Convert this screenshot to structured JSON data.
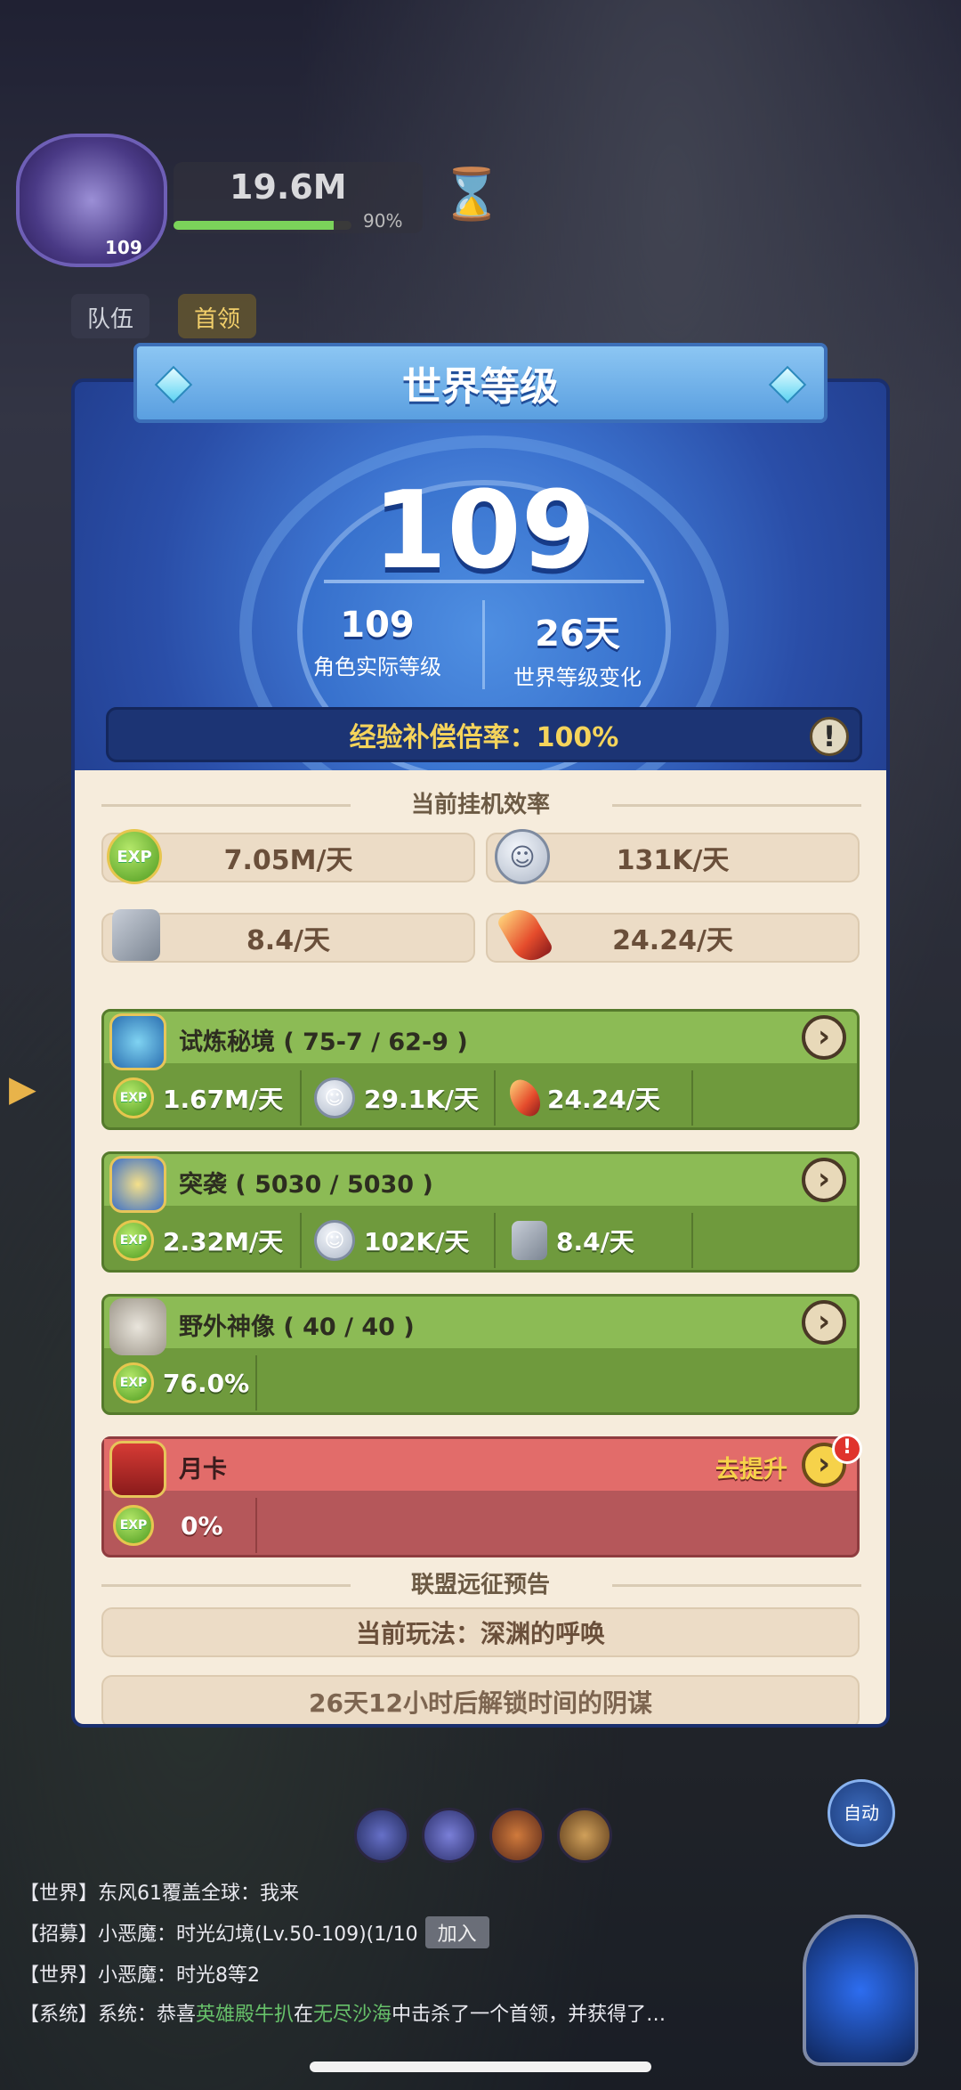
{
  "hud": {
    "avatar_level": "109",
    "power": "19.6M",
    "power_percent": "90%",
    "hp_fraction": 0.9,
    "tab_team": "队伍",
    "tab_boss": "首领"
  },
  "modal": {
    "title": "世界等级",
    "world_level": "109",
    "actual_level": "109",
    "actual_level_label": "角色实际等级",
    "change_days": "26天",
    "change_days_label": "世界等级变化",
    "compensation": "经验补偿倍率：100%",
    "warn_icon": "!",
    "idle_title": "当前挂机效率",
    "rates": {
      "exp": "7.05M/天",
      "coin": "131K/天",
      "stone": "8.4/天",
      "crystal": "24.24/天"
    },
    "exp_label": "EXP",
    "cards": [
      {
        "title": "试炼秘境 ( 75-7 / 62-9 )",
        "cells": [
          "1.67M/天",
          "29.1K/天",
          "24.24/天"
        ]
      },
      {
        "title": "突袭 ( 5030 / 5030 )",
        "cells": [
          "2.32M/天",
          "102K/天",
          "8.4/天"
        ]
      },
      {
        "title": "野外神像 ( 40 / 40 )",
        "cells": [
          "76.0%"
        ]
      },
      {
        "title": "月卡",
        "upgrade": "去提升",
        "cells": [
          "0%"
        ]
      }
    ],
    "alliance_title": "联盟远征预告",
    "current_play": "当前玩法：深渊的呼唤",
    "next_play_partial": "26天12小时后解锁时间的阴谋"
  },
  "chat": {
    "line1_prefix": "【世界】东风61覆盖全球：",
    "line1_msg": "我来",
    "line2": "【招募】小恶魔：时光幻境(Lv.50-109)(1/10",
    "join": "加入",
    "line3": "【世界】小恶魔：时光8等2",
    "line4_prefix": "【系统】系统：恭喜",
    "line4_name": "英雄殿牛扒",
    "line4_mid": "在",
    "line4_place": "无尽沙海",
    "line4_suffix": "中击杀了一个首领，并获得了…",
    "auto": "自动"
  },
  "colors": {
    "accent_gold": "#f5d45b",
    "card_green": "#8cbb55",
    "card_red": "#e26c6a",
    "panel_blue": "#3c73cf"
  }
}
